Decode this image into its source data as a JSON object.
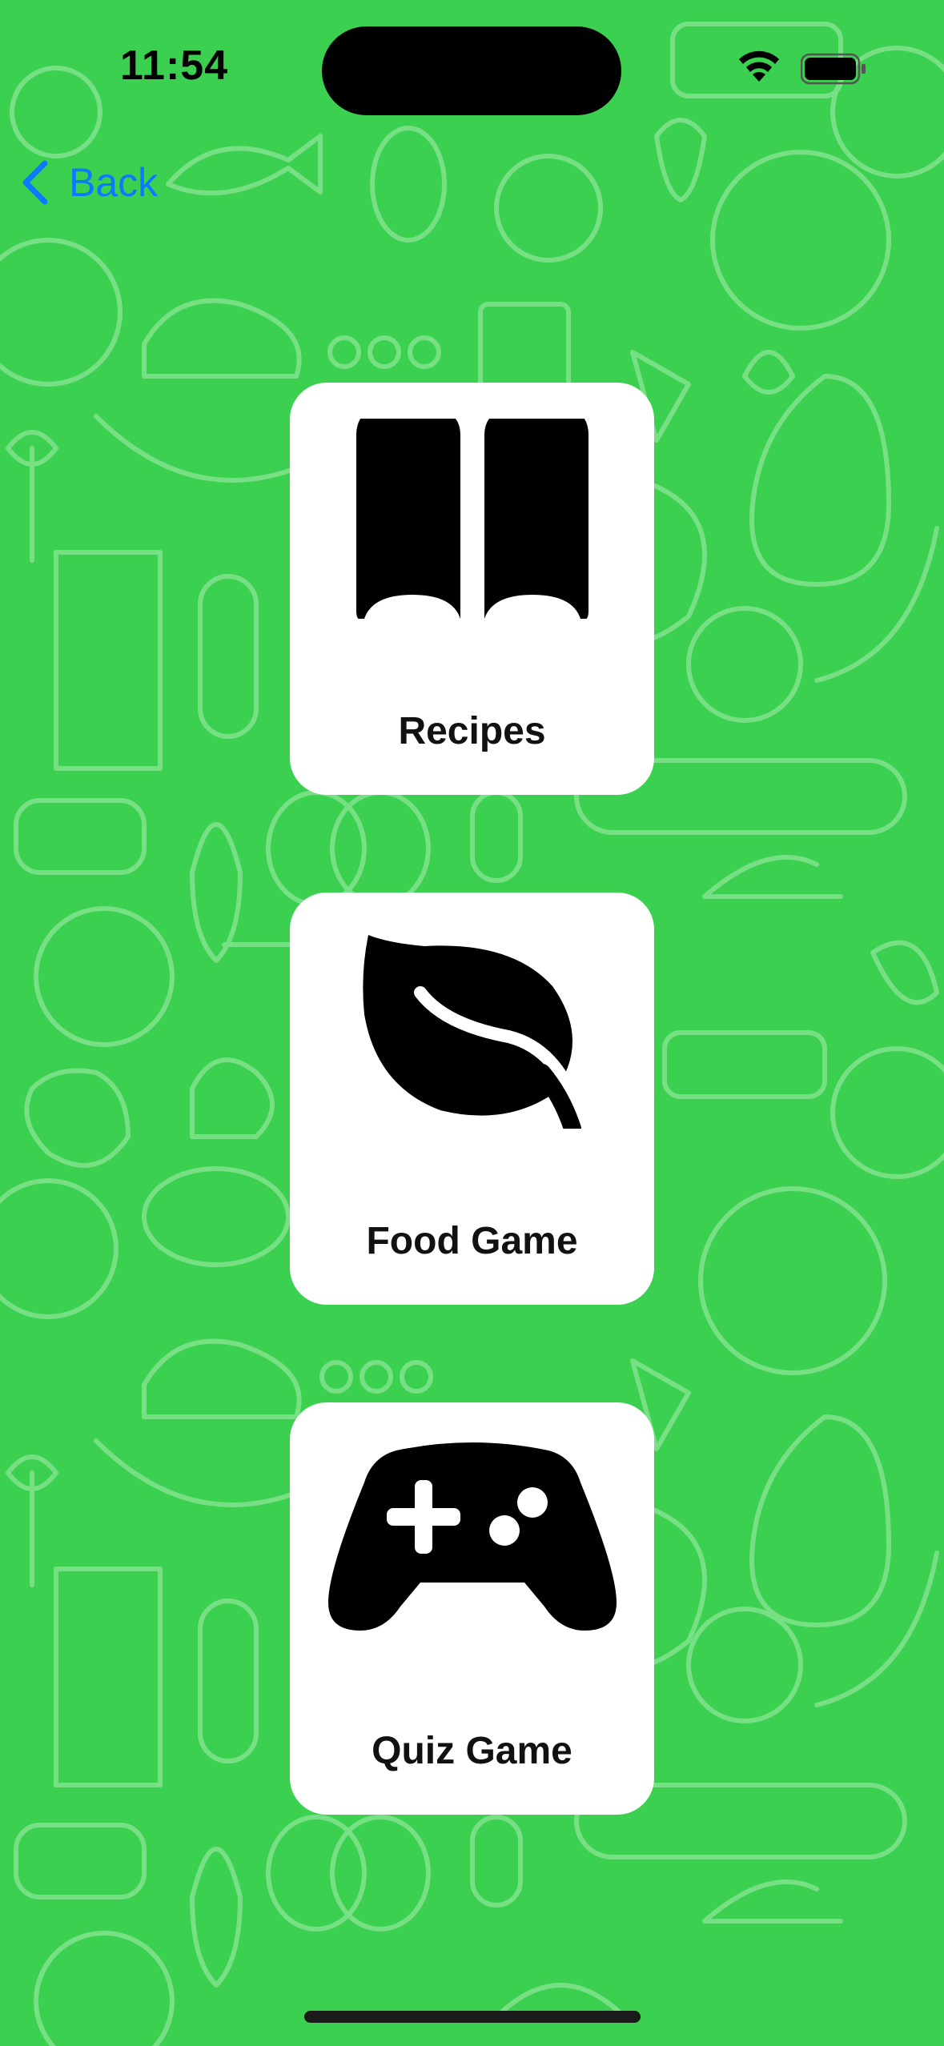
{
  "status_bar": {
    "time": "11:54",
    "icons": [
      "wifi-icon",
      "battery-icon"
    ]
  },
  "nav": {
    "back_label": "Back",
    "back_icon": "chevron-left-icon"
  },
  "cards": [
    {
      "label": "Recipes",
      "icon": "open-book-icon"
    },
    {
      "label": "Food Game",
      "icon": "leaf-icon"
    },
    {
      "label": "Quiz Game",
      "icon": "gamecontroller-icon"
    }
  ],
  "colors": {
    "background": "#3bd04f",
    "pattern_stroke": "#b8f0bd",
    "accent": "#0a7aff",
    "card": "#ffffff",
    "icon": "#000000"
  }
}
